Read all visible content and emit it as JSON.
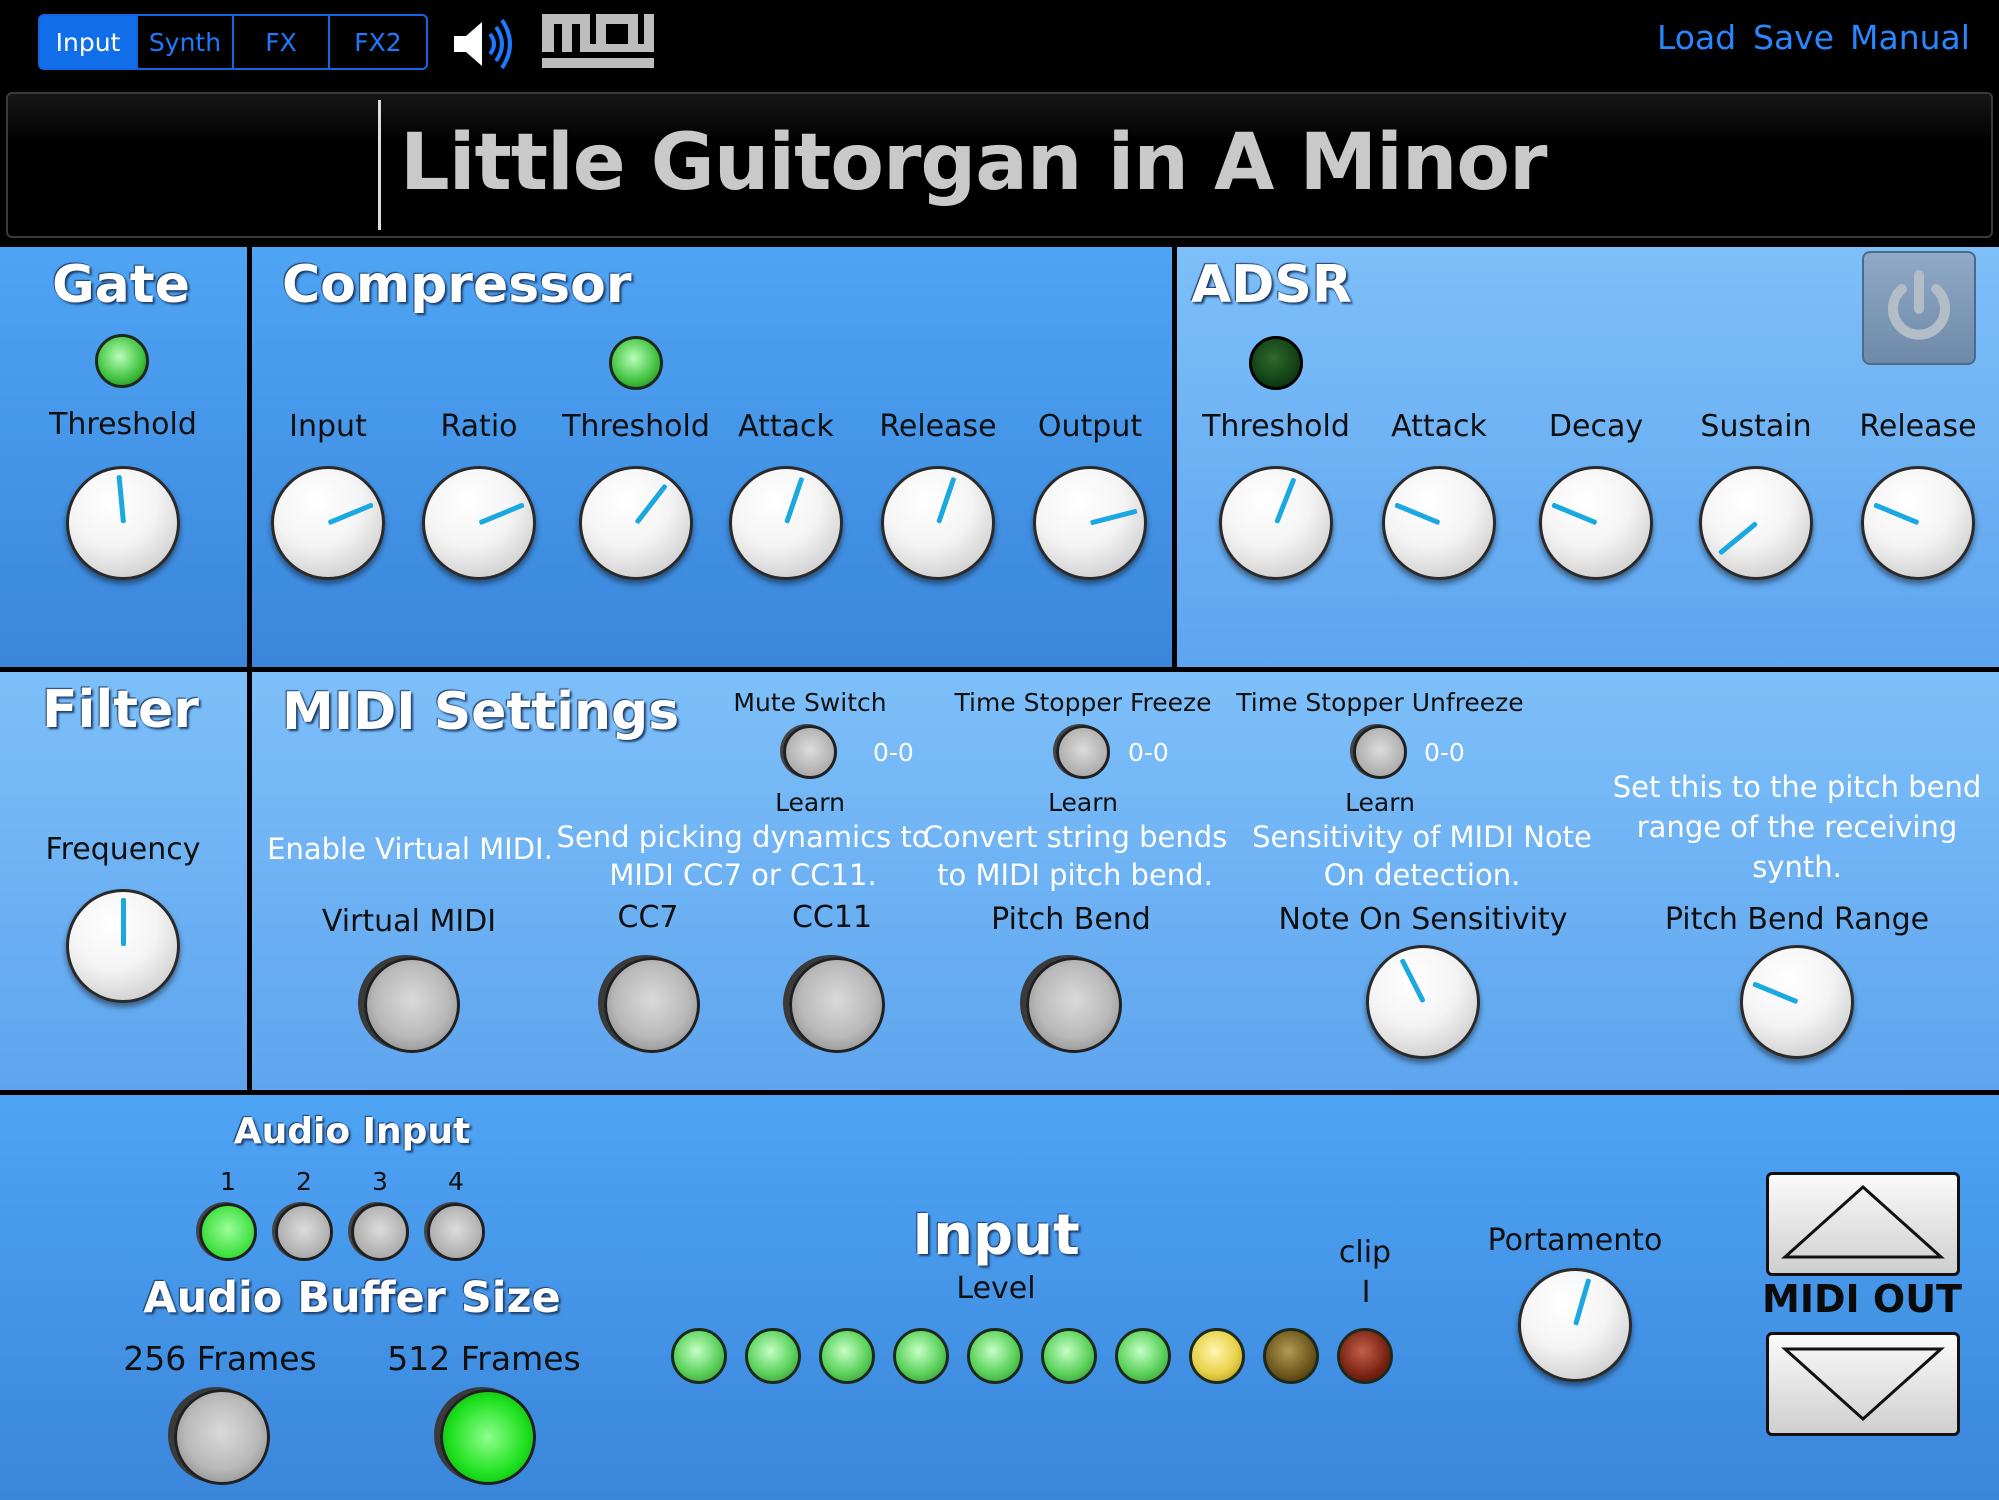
{
  "tabs": [
    {
      "label": "Input",
      "active": true
    },
    {
      "label": "Synth",
      "active": false
    },
    {
      "label": "FX",
      "active": false
    },
    {
      "label": "FX2",
      "active": false
    }
  ],
  "top_icons": {
    "speaker": "speaker-icon",
    "midi": "midi-logo"
  },
  "menu": {
    "load": "Load",
    "save": "Save",
    "manual": "Manual"
  },
  "title": "Little Guitorgan in A Minor",
  "colors": {
    "accent": "#1a7bff",
    "panel": "#4a9df2",
    "knob_indicator": "#1aa8e0",
    "led_green": "#2fd12f"
  },
  "gate": {
    "title": "Gate",
    "threshold_label": "Threshold",
    "led": "on",
    "threshold_value": 0.48
  },
  "compressor": {
    "title": "Compressor",
    "led": "on",
    "knobs": [
      {
        "label": "Input",
        "value": 0.75
      },
      {
        "label": "Ratio",
        "value": 0.75
      },
      {
        "label": "Threshold",
        "value": 0.64
      },
      {
        "label": "Attack",
        "value": 0.57
      },
      {
        "label": "Release",
        "value": 0.57
      },
      {
        "label": "Output",
        "value": 0.78
      }
    ]
  },
  "adsr": {
    "title": "ADSR",
    "led": "off",
    "power_icon": "power-icon",
    "knobs": [
      {
        "label": "Threshold",
        "value": 0.58
      },
      {
        "label": "Attack",
        "value": 0.25
      },
      {
        "label": "Decay",
        "value": 0.25
      },
      {
        "label": "Sustain",
        "value": 0.02
      },
      {
        "label": "Release",
        "value": 0.25
      }
    ]
  },
  "filter": {
    "title": "Filter",
    "frequency_label": "Frequency",
    "frequency_value": 0.5
  },
  "midi_settings": {
    "title": "MIDI Settings",
    "mute_switch": {
      "label": "Mute Switch",
      "value": "0-0",
      "learn": "Learn"
    },
    "freeze": {
      "label": "Time Stopper Freeze",
      "value": "0-0",
      "learn": "Learn"
    },
    "unfreeze": {
      "label": "Time Stopper Unfreeze",
      "value": "0-0",
      "learn": "Learn"
    },
    "virtual_midi": {
      "desc": "Enable Virtual MIDI.",
      "label": "Virtual MIDI"
    },
    "dynamics": {
      "desc1": "Send picking dynamics to",
      "desc2": "MIDI CC7 or CC11.",
      "cc7": "CC7",
      "cc11": "CC11"
    },
    "pitch_bend": {
      "desc1": "Convert string bends",
      "desc2": "to MIDI pitch bend.",
      "label": "Pitch Bend"
    },
    "note_on": {
      "desc1": "Sensitivity of MIDI Note",
      "desc2": "On detection.",
      "label": "Note On Sensitivity",
      "value": 0.4
    },
    "pb_range": {
      "desc1": "Set this to the pitch bend",
      "desc2": "range of the receiving",
      "desc3": "synth.",
      "label": "Pitch Bend Range",
      "value": 0.25
    }
  },
  "audio_input": {
    "title": "Audio Input",
    "channels": [
      {
        "label": "1",
        "selected": true
      },
      {
        "label": "2",
        "selected": false
      },
      {
        "label": "3",
        "selected": false
      },
      {
        "label": "4",
        "selected": false
      }
    ]
  },
  "audio_buffer": {
    "title": "Audio Buffer Size",
    "opt1": "256 Frames",
    "opt2": "512 Frames",
    "selected": "512 Frames"
  },
  "input_meter": {
    "title": "Input",
    "level_label": "Level",
    "clip_label": "clip",
    "clip_mark": "I",
    "leds": [
      {
        "state": "green"
      },
      {
        "state": "green"
      },
      {
        "state": "green"
      },
      {
        "state": "green"
      },
      {
        "state": "green"
      },
      {
        "state": "green"
      },
      {
        "state": "green"
      },
      {
        "state": "yellow"
      },
      {
        "state": "dim-amber"
      },
      {
        "state": "dim-red"
      }
    ]
  },
  "portamento": {
    "label": "Portamento",
    "value": 0.56
  },
  "midi_out": {
    "label": "MIDI OUT",
    "up_icon": "up-arrow-icon",
    "down_icon": "down-arrow-icon"
  }
}
